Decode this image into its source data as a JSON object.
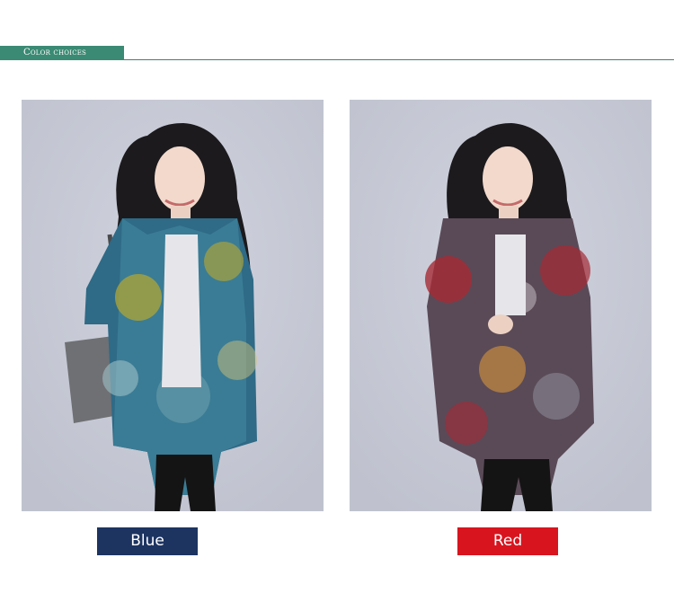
{
  "header": {
    "title": "Color choices"
  },
  "colors": [
    {
      "label": "Blue",
      "swatch": "#1d3461"
    },
    {
      "label": "Red",
      "swatch": "#d8151f"
    }
  ],
  "accent": "#3b8a73"
}
